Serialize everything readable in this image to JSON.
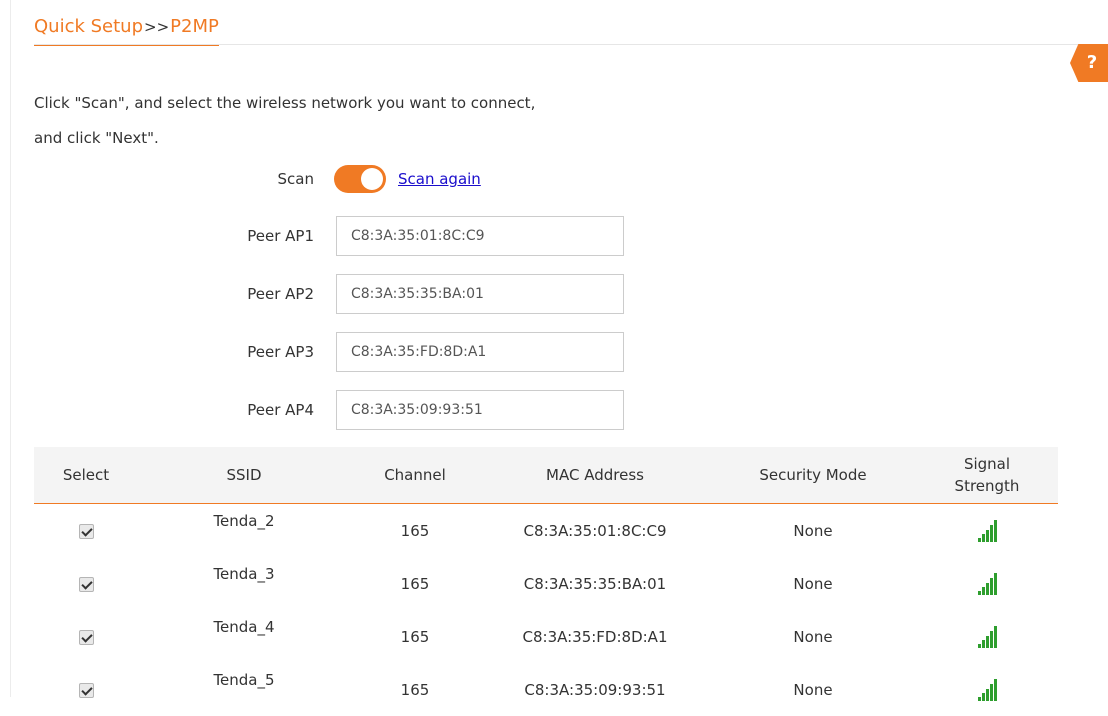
{
  "header": {
    "breadcrumb_root": "Quick Setup",
    "breadcrumb_sep": ">>",
    "breadcrumb_current": "P2MP",
    "help_label": "?"
  },
  "intro": {
    "line1": "Click \"Scan\", and select the wireless network you want to connect,",
    "line2": "and click \"Next\"."
  },
  "scan": {
    "label": "Scan",
    "enabled": true,
    "scan_again_label": "Scan again"
  },
  "peers": [
    {
      "label": "Peer AP1",
      "value": "C8:3A:35:01:8C:C9"
    },
    {
      "label": "Peer AP2",
      "value": "C8:3A:35:35:BA:01"
    },
    {
      "label": "Peer AP3",
      "value": "C8:3A:35:FD:8D:A1"
    },
    {
      "label": "Peer AP4",
      "value": "C8:3A:35:09:93:51"
    }
  ],
  "table": {
    "headers": {
      "select": "Select",
      "ssid": "SSID",
      "channel": "Channel",
      "mac": "MAC Address",
      "security": "Security Mode",
      "signal": "Signal Strength"
    },
    "rows": [
      {
        "selected": true,
        "ssid": "Tenda_2",
        "channel": "165",
        "mac": "C8:3A:35:01:8C:C9",
        "security": "None",
        "signal_icon": "signal-strength-icon"
      },
      {
        "selected": true,
        "ssid": "Tenda_3",
        "channel": "165",
        "mac": "C8:3A:35:35:BA:01",
        "security": "None",
        "signal_icon": "signal-strength-icon"
      },
      {
        "selected": true,
        "ssid": "Tenda_4",
        "channel": "165",
        "mac": "C8:3A:35:FD:8D:A1",
        "security": "None",
        "signal_icon": "signal-strength-icon"
      },
      {
        "selected": true,
        "ssid": "Tenda_5",
        "channel": "165",
        "mac": "C8:3A:35:09:93:51",
        "security": "None",
        "signal_icon": "signal-strength-icon"
      }
    ]
  },
  "colors": {
    "accent": "#f07a24",
    "link": "#1a0dcc",
    "signal": "#2e9e2e",
    "table_header_bg": "#f4f4f4"
  }
}
